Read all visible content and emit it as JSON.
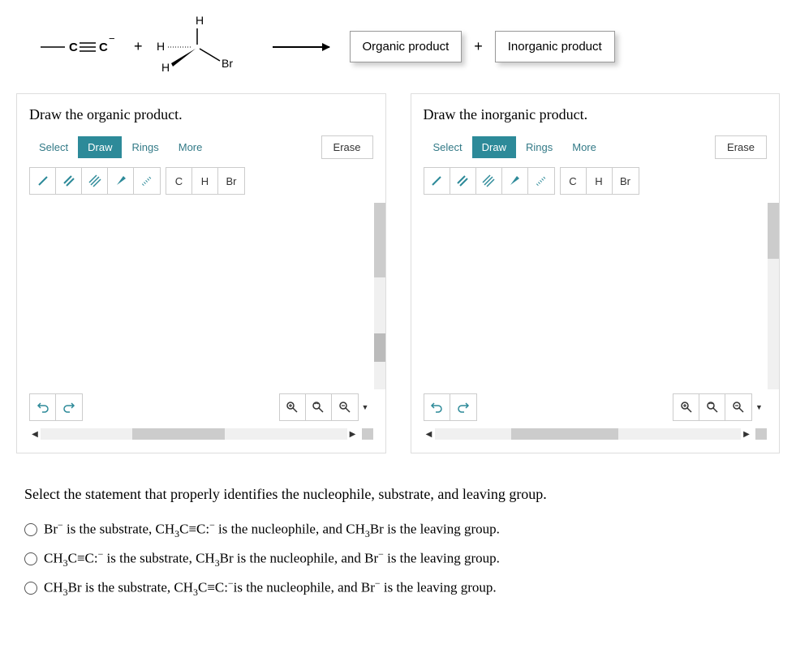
{
  "reaction": {
    "plus1": "+",
    "plus2": "+",
    "organic_box": "Organic product",
    "inorganic_box": "Inorganic product"
  },
  "panel_left": {
    "title": "Draw the organic product.",
    "tabs": {
      "select": "Select",
      "draw": "Draw",
      "rings": "Rings",
      "more": "More"
    },
    "erase": "Erase",
    "atoms": {
      "c": "C",
      "h": "H",
      "br": "Br"
    }
  },
  "panel_right": {
    "title": "Draw the inorganic product.",
    "tabs": {
      "select": "Select",
      "draw": "Draw",
      "rings": "Rings",
      "more": "More"
    },
    "erase": "Erase",
    "atoms": {
      "c": "C",
      "h": "H",
      "br": "Br"
    }
  },
  "question": "Select the statement that properly identifies the nucleophile, substrate, and leaving group.",
  "options": {
    "a_pre": "Br",
    "a_post": " is the substrate, CH",
    "a_mid": "C≡C:",
    "a_mid2": " is the nucleophile, and CH",
    "a_end": "Br is the leaving group.",
    "b_pre": "CH",
    "b_mid": "C≡C:",
    "b_mid2": " is the substrate, CH",
    "b_mid3": "Br is the nucleophile, and Br",
    "b_end": " is the leaving group.",
    "c_pre": "CH",
    "c_mid": "Br is the substrate, CH",
    "c_mid2": "C≡C:",
    "c_mid3": "is the nucleophile, and Br",
    "c_end": " is the leaving group.",
    "sub3": "3",
    "minus": "−"
  }
}
